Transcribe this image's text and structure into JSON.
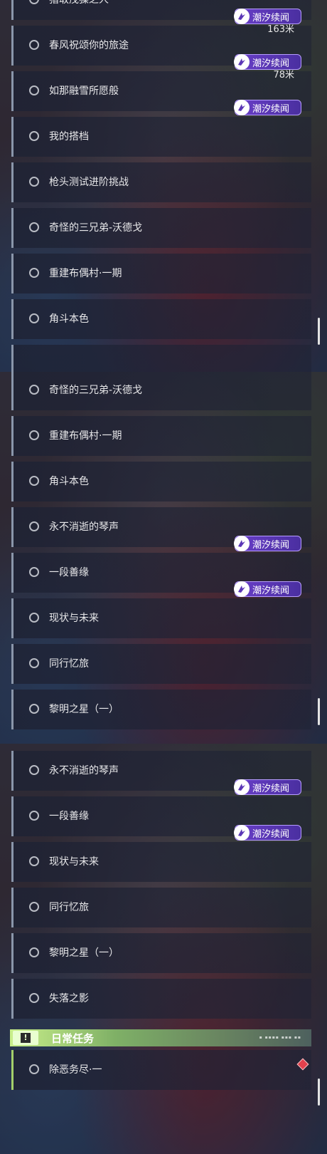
{
  "badge_label": "潮汐续闻",
  "panel1": {
    "rows": [
      {
        "label": "猎取茂猱之人"
      },
      {
        "label": "春风祝颂你的旅途",
        "distance": "163米",
        "badge": true
      },
      {
        "label": "如那融雪所愿般",
        "distance": "78米",
        "badge": true
      },
      {
        "label": "我的搭档",
        "badge": true
      },
      {
        "label": "枪头测试进阶挑战"
      },
      {
        "label": "奇怪的三兄弟-沃德戈"
      },
      {
        "label": "重建布偶村·一期"
      },
      {
        "label": "角斗本色"
      }
    ]
  },
  "panel2": {
    "rows": [
      {
        "label": "奇怪的三兄弟-沃德戈"
      },
      {
        "label": "重建布偶村·一期"
      },
      {
        "label": "角斗本色"
      },
      {
        "label": "永不消逝的琴声"
      },
      {
        "label": "一段善缘",
        "badge": true
      },
      {
        "label": "现状与未来",
        "badge": true
      },
      {
        "label": "同行忆旅"
      },
      {
        "label": "黎明之星（一）"
      }
    ]
  },
  "panel3": {
    "rows": [
      {
        "label": "永不消逝的琴声"
      },
      {
        "label": "一段善缘",
        "badge": true
      },
      {
        "label": "现状与未来",
        "badge": true
      },
      {
        "label": "同行忆旅"
      },
      {
        "label": "黎明之星（一）"
      },
      {
        "label": "失落之影"
      }
    ],
    "section": {
      "title": "日常任务",
      "icon": "exclamation-icon"
    },
    "daily_rows": [
      {
        "label": "除恶务尽·一"
      }
    ]
  },
  "colors": {
    "badge_bg": "#5b36b6",
    "section_accent": "#c9ef8a",
    "diamond": "#e2414d"
  }
}
